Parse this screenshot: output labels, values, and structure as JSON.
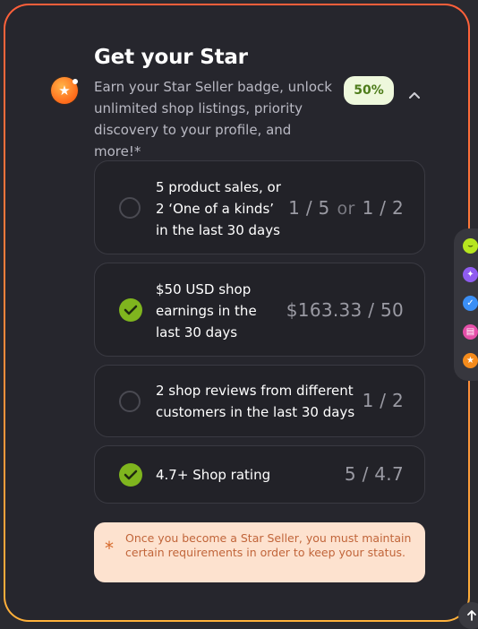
{
  "header": {
    "title": "Get your Star",
    "subtitle": "Earn your Star Seller badge, unlock unlimited shop listings, priority discovery to your profile, and more!*",
    "progress_label": "50%",
    "progress_fraction": 0.5,
    "badge_icon": "star-seller-icon",
    "collapse_icon": "chevron-up-icon"
  },
  "requirements": [
    {
      "line1": "5 product sales, or",
      "line2": "2 ‘One of a kinds’",
      "line3": "in the last 30 days",
      "value_a": "1 / 5",
      "or_label": "or",
      "value_b": "1 / 2",
      "status": "incomplete"
    },
    {
      "line1": "$50 USD shop",
      "line2": "earnings in the",
      "line3": "last 30 days",
      "value": "$163.33 / 50",
      "status": "complete"
    },
    {
      "line1": "2 shop reviews from different",
      "line2": "customers in the last 30 days",
      "value": "1 / 2",
      "status": "incomplete"
    },
    {
      "line1": "4.7+ Shop rating",
      "value": "5 / 4.7",
      "status": "complete"
    }
  ],
  "note": {
    "icon": "asterisk-icon",
    "text": "Once you become a Star Seller, you must maintain certain requirements in order to keep your status."
  },
  "side_rail": {
    "items": [
      {
        "icon": "sprout-icon",
        "color": "#b6e51f"
      },
      {
        "icon": "sparkle-icon",
        "color": "#8f5cf0"
      },
      {
        "icon": "verified-check-icon",
        "color": "#3b8ff5"
      },
      {
        "icon": "shop-icon",
        "color": "#e44fa8"
      },
      {
        "icon": "star-icon",
        "color": "#f48b1c"
      }
    ]
  },
  "scroll_top": {
    "icon": "arrow-up-icon"
  },
  "colors": {
    "accent_complete": "#7fb51e",
    "card_bg": "#26262d",
    "border_gradient_start": "#ff5f3a",
    "border_gradient_end": "#ffb13a",
    "note_bg": "#fde2cf"
  }
}
